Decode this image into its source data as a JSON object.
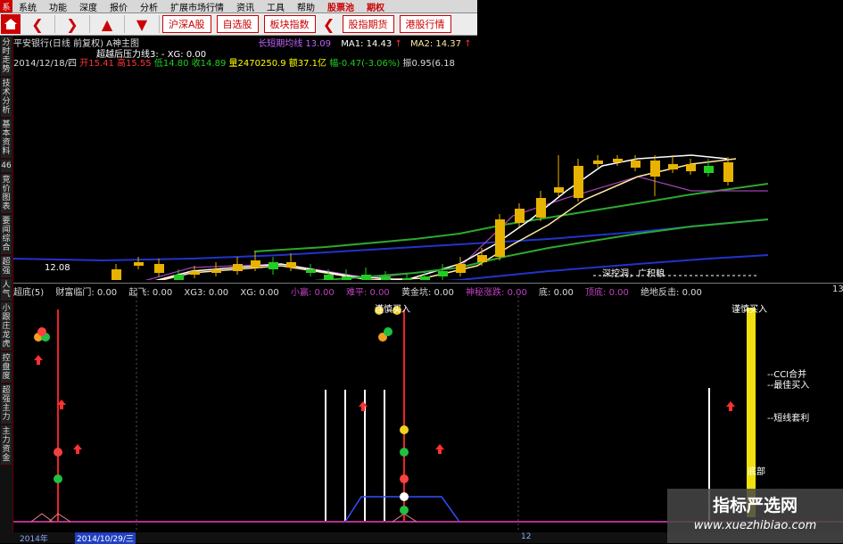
{
  "menu": {
    "items": [
      "系统",
      "功能",
      "深度",
      "报价",
      "分析",
      "扩展市场行情",
      "资讯",
      "工具",
      "帮助"
    ],
    "right_items": [
      "股票池",
      "期权"
    ],
    "logo": "系"
  },
  "toolbar": {
    "nav_buttons": [
      "沪深A股",
      "自选股",
      "板块指数"
    ],
    "right_buttons": [
      "股指期货",
      "港股行情"
    ]
  },
  "sidebar": {
    "items": [
      "分时走势",
      "技术分析",
      "基本资料",
      "46",
      "竞价图表",
      "要闻综合",
      "超强",
      "人气",
      "小跟庄龙虎",
      "控盘度",
      "超强主力",
      "主力资金"
    ]
  },
  "upper": {
    "title": "平安银行(日线 前复权) A神主图",
    "ma_label": "长短期均线",
    "ma0_value": "13.09",
    "ma1_label": "MA1:",
    "ma1_value": "14.43",
    "ma2_label": "MA2:",
    "ma2_value": "14.37",
    "line2": "超越后压力线3: - XG: 0.00",
    "date": "2014/12/18/四",
    "open": "开15.41",
    "high": "高15.55",
    "low": "低14.80",
    "close": "收14.89",
    "volume": "量2470250.9",
    "amount": "额37.1亿",
    "change": "幅-0.47(-3.06%)",
    "amplitude": "振0.95(6.18",
    "annotation": "深挖洞，广积粮",
    "low_marker": "12.08"
  },
  "lower": {
    "labels": [
      "超底(5)",
      "财富临门: 0.00",
      "起飞: 0.00",
      "XG3: 0.00",
      "XG: 0.00",
      "小赢: 0.00",
      "难平: 0.00",
      "黄金坑: 0.00",
      "神秘涨跌: 0.00",
      "底: 0.00",
      "顶底: 0.00",
      "绝地反击: 0.00"
    ],
    "buy_label_1": "谨慎买入",
    "buy_label_2": "谨慎买入",
    "cci_label": "--CCI合并",
    "best_buy": "--最佳买入",
    "short_arb": "--短线套利",
    "bottom_label": "底部",
    "right_num": "13"
  },
  "bottom": {
    "year": "2014年",
    "date": "2014/10/29/三",
    "right": "12"
  },
  "watermark": {
    "title": "指标严选网",
    "url": "www.xuezhibiao.com"
  },
  "colors": {
    "up": "#e8b200",
    "down": "#22cc22",
    "ma_white": "#ffffff",
    "ma_yellow": "#ffe8a0",
    "ma_green": "#2ea82e",
    "ma_blue": "#2233cc",
    "ma_purple": "#a040b0"
  }
}
